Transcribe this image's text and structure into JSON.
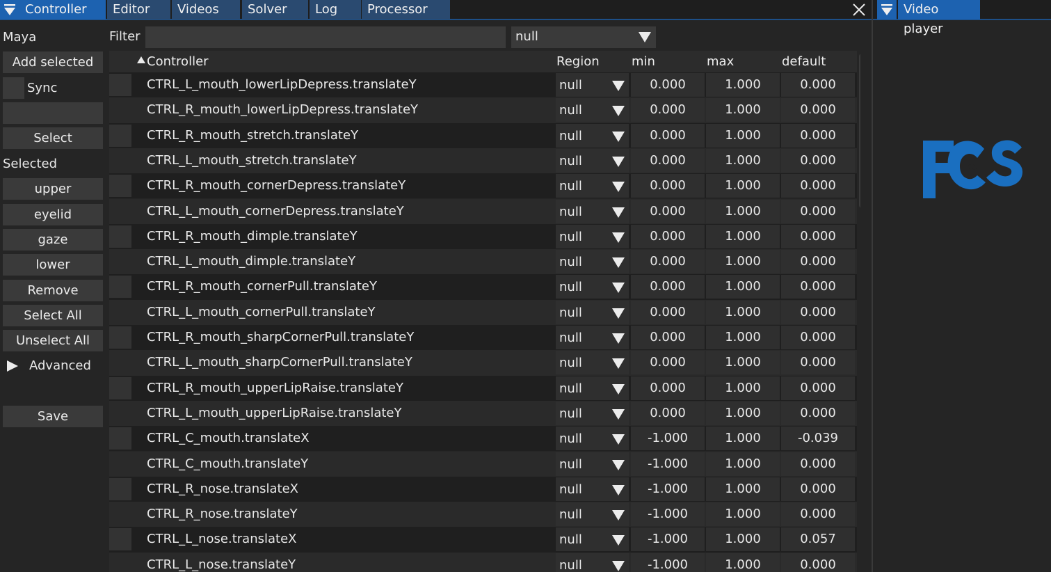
{
  "main_tabs": [
    {
      "label": "Controller",
      "active": true
    },
    {
      "label": "Editor",
      "active": false
    },
    {
      "label": "Videos",
      "active": false
    },
    {
      "label": "Solver",
      "active": false
    },
    {
      "label": "Log",
      "active": false
    },
    {
      "label": "Processor",
      "active": false
    }
  ],
  "right_tab": {
    "label": "Video player"
  },
  "sidebar": {
    "maya_label": "Maya",
    "add_selected": "Add selected",
    "sync_label": "Sync",
    "select": "Select",
    "selected_label": "Selected",
    "upper": "upper",
    "eyelid": "eyelid",
    "gaze": "gaze",
    "lower": "lower",
    "remove": "Remove",
    "select_all": "Select All",
    "unselect_all": "Unselect All",
    "advanced": "Advanced",
    "save": "Save"
  },
  "filter": {
    "label": "Filter",
    "value": "",
    "combo_value": "null"
  },
  "table": {
    "headers": {
      "controller": "Controller",
      "region": "Region",
      "min": "min",
      "max": "max",
      "default": "default"
    },
    "rows": [
      {
        "name": "CTRL_L_mouth_lowerLipDepress.translateY",
        "region": "null",
        "min": "0.000",
        "max": "1.000",
        "default": "0.000"
      },
      {
        "name": "CTRL_R_mouth_lowerLipDepress.translateY",
        "region": "null",
        "min": "0.000",
        "max": "1.000",
        "default": "0.000"
      },
      {
        "name": "CTRL_R_mouth_stretch.translateY",
        "region": "null",
        "min": "0.000",
        "max": "1.000",
        "default": "0.000"
      },
      {
        "name": "CTRL_L_mouth_stretch.translateY",
        "region": "null",
        "min": "0.000",
        "max": "1.000",
        "default": "0.000"
      },
      {
        "name": "CTRL_R_mouth_cornerDepress.translateY",
        "region": "null",
        "min": "0.000",
        "max": "1.000",
        "default": "0.000"
      },
      {
        "name": "CTRL_L_mouth_cornerDepress.translateY",
        "region": "null",
        "min": "0.000",
        "max": "1.000",
        "default": "0.000"
      },
      {
        "name": "CTRL_R_mouth_dimple.translateY",
        "region": "null",
        "min": "0.000",
        "max": "1.000",
        "default": "0.000"
      },
      {
        "name": "CTRL_L_mouth_dimple.translateY",
        "region": "null",
        "min": "0.000",
        "max": "1.000",
        "default": "0.000"
      },
      {
        "name": "CTRL_R_mouth_cornerPull.translateY",
        "region": "null",
        "min": "0.000",
        "max": "1.000",
        "default": "0.000"
      },
      {
        "name": "CTRL_L_mouth_cornerPull.translateY",
        "region": "null",
        "min": "0.000",
        "max": "1.000",
        "default": "0.000"
      },
      {
        "name": "CTRL_R_mouth_sharpCornerPull.translateY",
        "region": "null",
        "min": "0.000",
        "max": "1.000",
        "default": "0.000"
      },
      {
        "name": "CTRL_L_mouth_sharpCornerPull.translateY",
        "region": "null",
        "min": "0.000",
        "max": "1.000",
        "default": "0.000"
      },
      {
        "name": "CTRL_R_mouth_upperLipRaise.translateY",
        "region": "null",
        "min": "0.000",
        "max": "1.000",
        "default": "0.000"
      },
      {
        "name": "CTRL_L_mouth_upperLipRaise.translateY",
        "region": "null",
        "min": "0.000",
        "max": "1.000",
        "default": "0.000"
      },
      {
        "name": "CTRL_C_mouth.translateX",
        "region": "null",
        "min": "-1.000",
        "max": "1.000",
        "default": "-0.039"
      },
      {
        "name": "CTRL_C_mouth.translateY",
        "region": "null",
        "min": "-1.000",
        "max": "1.000",
        "default": "0.000"
      },
      {
        "name": "CTRL_R_nose.translateX",
        "region": "null",
        "min": "-1.000",
        "max": "1.000",
        "default": "0.000"
      },
      {
        "name": "CTRL_R_nose.translateY",
        "region": "null",
        "min": "-1.000",
        "max": "1.000",
        "default": "0.000"
      },
      {
        "name": "CTRL_L_nose.translateX",
        "region": "null",
        "min": "-1.000",
        "max": "1.000",
        "default": "0.057"
      },
      {
        "name": "CTRL_L_nose.translateY",
        "region": "null",
        "min": "-1.000",
        "max": "1.000",
        "default": "0.000"
      }
    ]
  },
  "colors": {
    "accent": "#1d62b0",
    "tab_inactive": "#2a4a70",
    "logo": "#1a6fc0"
  }
}
